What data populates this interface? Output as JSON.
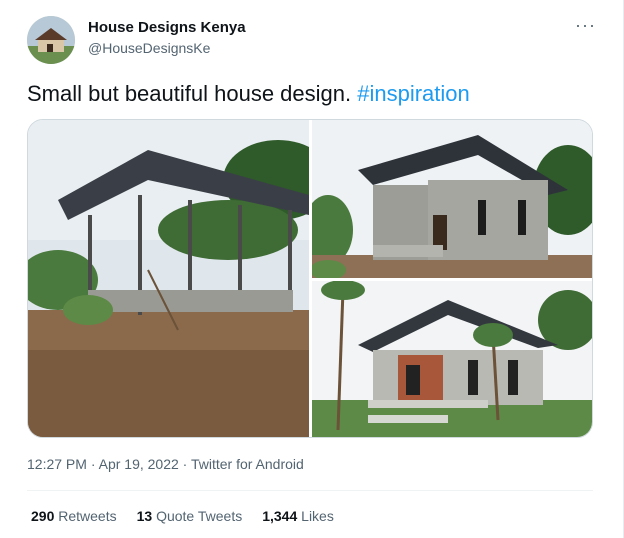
{
  "author": {
    "name": "House Designs Kenya",
    "handle": "@HouseDesignsKe"
  },
  "tweet": {
    "text": "Small but beautiful house design. ",
    "hashtag": "#inspiration"
  },
  "meta": {
    "time": "12:27 PM",
    "separator1": " · ",
    "date": "Apr 19, 2022",
    "separator2": " · ",
    "client": "Twitter for Android"
  },
  "stats": {
    "retweets_count": "290",
    "retweets_label": "Retweets",
    "quotes_count": "13",
    "quotes_label": "Quote Tweets",
    "likes_count": "1,344",
    "likes_label": "Likes"
  },
  "icons": {
    "more": "more-horizontal-icon"
  }
}
